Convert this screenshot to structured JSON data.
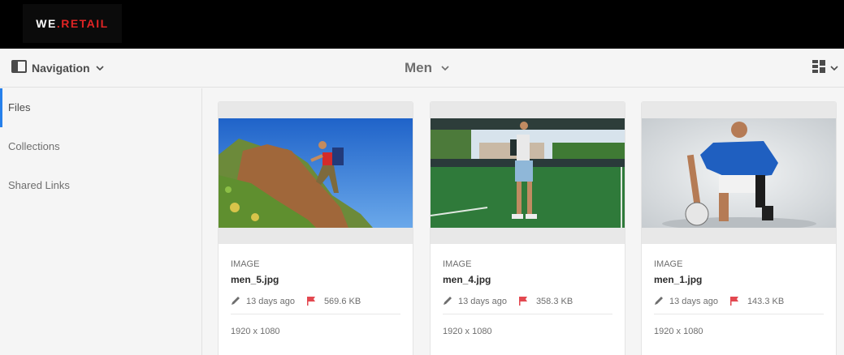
{
  "brand": {
    "logo_prefix": "WE",
    "logo_dot": ".",
    "logo_suffix": "RETAIL"
  },
  "header": {
    "navigation_label": "Navigation",
    "folder_title": "Men"
  },
  "sidebar": {
    "items": [
      {
        "label": "Files",
        "active": true
      },
      {
        "label": "Collections",
        "active": false
      },
      {
        "label": "Shared Links",
        "active": false
      }
    ]
  },
  "assets": [
    {
      "type": "IMAGE",
      "name": "men_5.jpg",
      "modified": "13 days ago",
      "size": "569.6 KB",
      "dimensions": "1920 x 1080"
    },
    {
      "type": "IMAGE",
      "name": "men_4.jpg",
      "modified": "13 days ago",
      "size": "358.3 KB",
      "dimensions": "1920 x 1080"
    },
    {
      "type": "IMAGE",
      "name": "men_1.jpg",
      "modified": "13 days ago",
      "size": "143.3 KB",
      "dimensions": "1920 x 1080"
    }
  ],
  "icons": {
    "nav_toggle": "sidebar-panel-icon",
    "chevron": "chevron-down-icon",
    "view_switcher": "grid-view-icon",
    "modified": "pencil-icon",
    "flag": "flag-icon"
  },
  "colors": {
    "accent": "#2680eb",
    "brand_red": "#e02424",
    "flag": "#e34850"
  }
}
